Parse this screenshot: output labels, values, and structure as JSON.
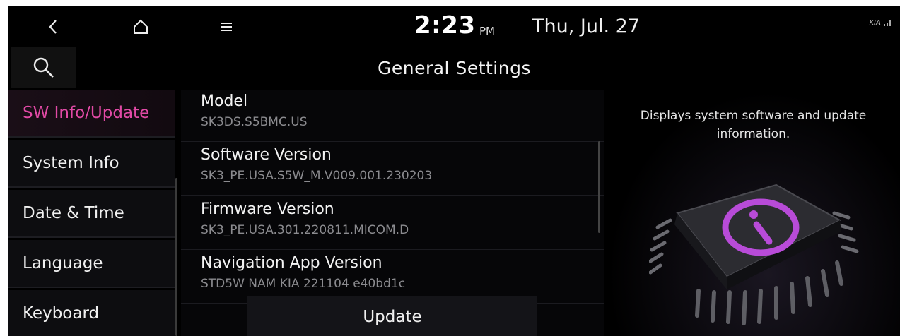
{
  "status": {
    "time": "2:23",
    "ampm": "PM",
    "date": "Thu, Jul. 27",
    "brand": "KIA"
  },
  "header": {
    "title": "General Settings"
  },
  "sidebar": {
    "items": [
      {
        "label": "SW Info/Update",
        "active": true
      },
      {
        "label": "System Info",
        "active": false
      },
      {
        "label": "Date & Time",
        "active": false
      },
      {
        "label": "Language",
        "active": false
      },
      {
        "label": "Keyboard",
        "active": false
      }
    ]
  },
  "info_rows": [
    {
      "title": "Model",
      "value": "SK3DS.S5BMC.US"
    },
    {
      "title": "Software Version",
      "value": "SK3_PE.USA.S5W_M.V009.001.230203"
    },
    {
      "title": "Firmware Version",
      "value": "SK3_PE.USA.301.220811.MICOM.D"
    },
    {
      "title": "Navigation App Version",
      "value": "STD5W NAM KIA 221104 e40bd1c"
    }
  ],
  "update_button": {
    "label": "Update"
  },
  "description": "Displays system software and update information.",
  "icons": {
    "back": "chevron-left-icon",
    "home": "home-icon",
    "menu": "hamburger-menu-icon",
    "search": "search-icon",
    "signal": "signal-icon",
    "info": "info-icon"
  },
  "colors": {
    "accent": "#e24aa6",
    "info_purple": "#b84bd8",
    "background": "#000000"
  }
}
